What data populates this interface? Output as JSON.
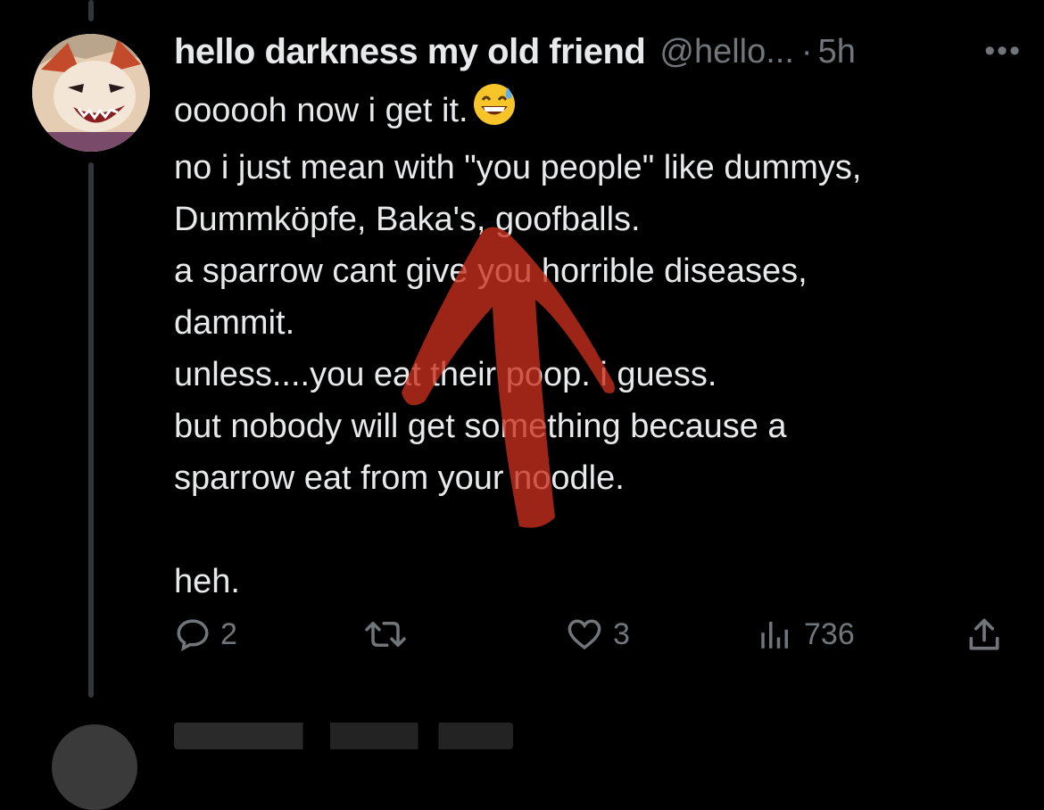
{
  "tweet": {
    "display_name": "hello darkness my old friend",
    "handle": "@hello...",
    "separator": "·",
    "time": "5h",
    "more_icon": "more-horizontal-icon",
    "line1": "oooooh now i get it.",
    "emoji": "grinning-face-with-sweat-emoji",
    "body": "no i just mean with \"you people\" like dummys,\nDummköpfe, Baka's, goofballs.\na sparrow cant give you horrible diseases,\ndammit.\nunless....you eat their poop. i guess.\nbut nobody will get something because a\nsparrow eat from your noodle.\n\nheh."
  },
  "actions": {
    "reply_count": "2",
    "retweet_count": "",
    "like_count": "3",
    "views_count": "736"
  },
  "colors": {
    "background": "#000000",
    "text": "#e7e9ea",
    "secondary": "#71767b",
    "annotation": "#c8301e"
  }
}
